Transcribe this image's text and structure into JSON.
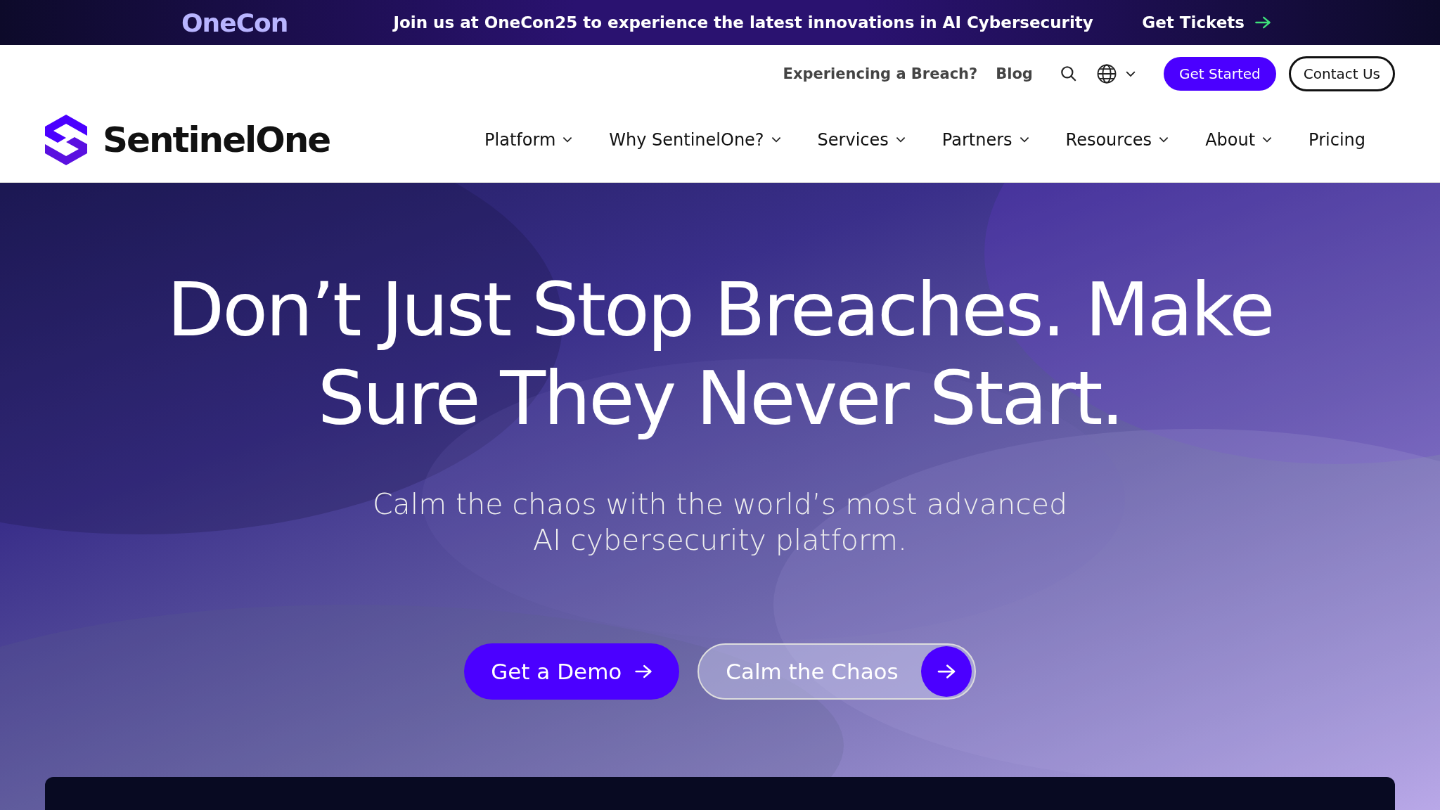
{
  "announcement": {
    "logo": "OneCon",
    "message": "Join us at OneCon25 to experience the latest innovations in AI Cybersecurity",
    "link": "Get Tickets"
  },
  "utility_nav": {
    "links": [
      "Experiencing a Breach?",
      "Blog"
    ],
    "get_started": "Get Started",
    "contact": "Contact Us"
  },
  "brand": "SentinelOne",
  "nav": [
    {
      "label": "Platform",
      "has_menu": true
    },
    {
      "label": "Why SentinelOne?",
      "has_menu": true
    },
    {
      "label": "Services",
      "has_menu": true
    },
    {
      "label": "Partners",
      "has_menu": true
    },
    {
      "label": "Resources",
      "has_menu": true
    },
    {
      "label": "About",
      "has_menu": true
    },
    {
      "label": "Pricing",
      "has_menu": false
    }
  ],
  "hero": {
    "headline": "Don’t Just Stop Breaches. Make Sure They Never Start.",
    "subtitle": "Calm the chaos with the world’s most advanced AI cybersecurity platform.",
    "primary_button": "Get a Demo",
    "secondary_button": "Calm the Chaos"
  }
}
